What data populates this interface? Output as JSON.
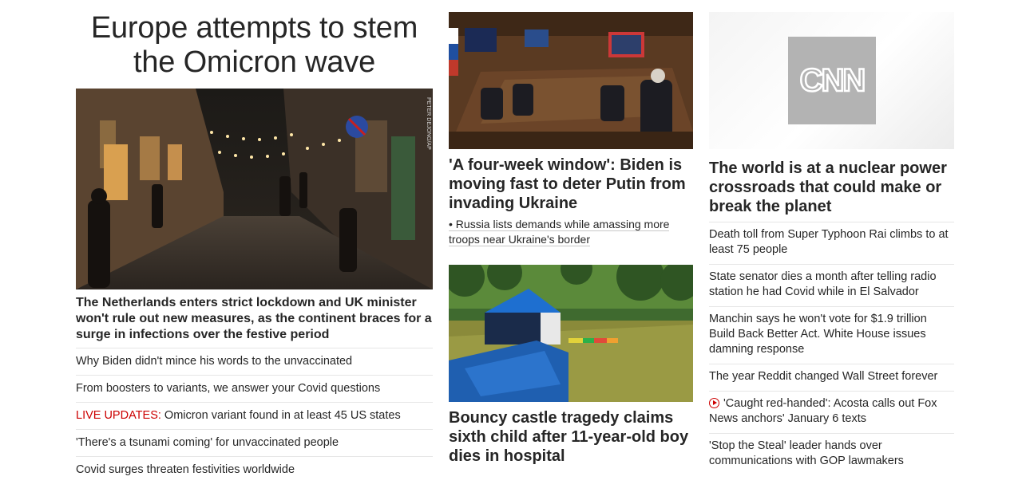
{
  "left": {
    "headline": "Europe attempts to stem the Omicron wave",
    "photo_credit": "PETER DEJONG/AP",
    "caption": "The Netherlands enters strict lockdown and UK minister won't rule out new measures, as the continent braces for a surge in infections over the festive period",
    "links": [
      {
        "text": "Why Biden didn't mince his words to the unvaccinated"
      },
      {
        "text": "From boosters to variants, we answer your Covid questions"
      },
      {
        "prefix": "LIVE UPDATES:",
        "text": " Omicron variant found in at least 45 US states"
      },
      {
        "text": "'There's a tsunami coming' for unvaccinated people"
      },
      {
        "text": "Covid surges threaten festivities worldwide"
      }
    ]
  },
  "middle": {
    "story1": {
      "headline": "'A four-week window': Biden is moving fast to deter Putin from invading Ukraine",
      "sub": "• Russia lists demands while amassing more troops near Ukraine's border"
    },
    "story2": {
      "headline": "Bouncy castle tragedy claims sixth child after 11-year-old boy dies in hospital"
    }
  },
  "right": {
    "logo": "CNN",
    "headline": "The world is at a nuclear power crossroads that could make or break the planet",
    "links": [
      {
        "text": "Death toll from Super Typhoon Rai climbs to at least 75 people"
      },
      {
        "text": "State senator dies a month after telling radio station he had Covid while in El Salvador"
      },
      {
        "text": "Manchin says he won't vote for $1.9 trillion Build Back Better Act. White House issues damning response"
      },
      {
        "text": "The year Reddit changed Wall Street forever"
      },
      {
        "text": "'Caught red-handed': Acosta calls out Fox News anchors' January 6 texts",
        "icon": "video-play-icon"
      },
      {
        "text": "'Stop the Steal' leader hands over communications with GOP lawmakers"
      }
    ]
  },
  "colors": {
    "live": "#cc0000",
    "text": "#262626",
    "divider": "#e6e6e6"
  }
}
